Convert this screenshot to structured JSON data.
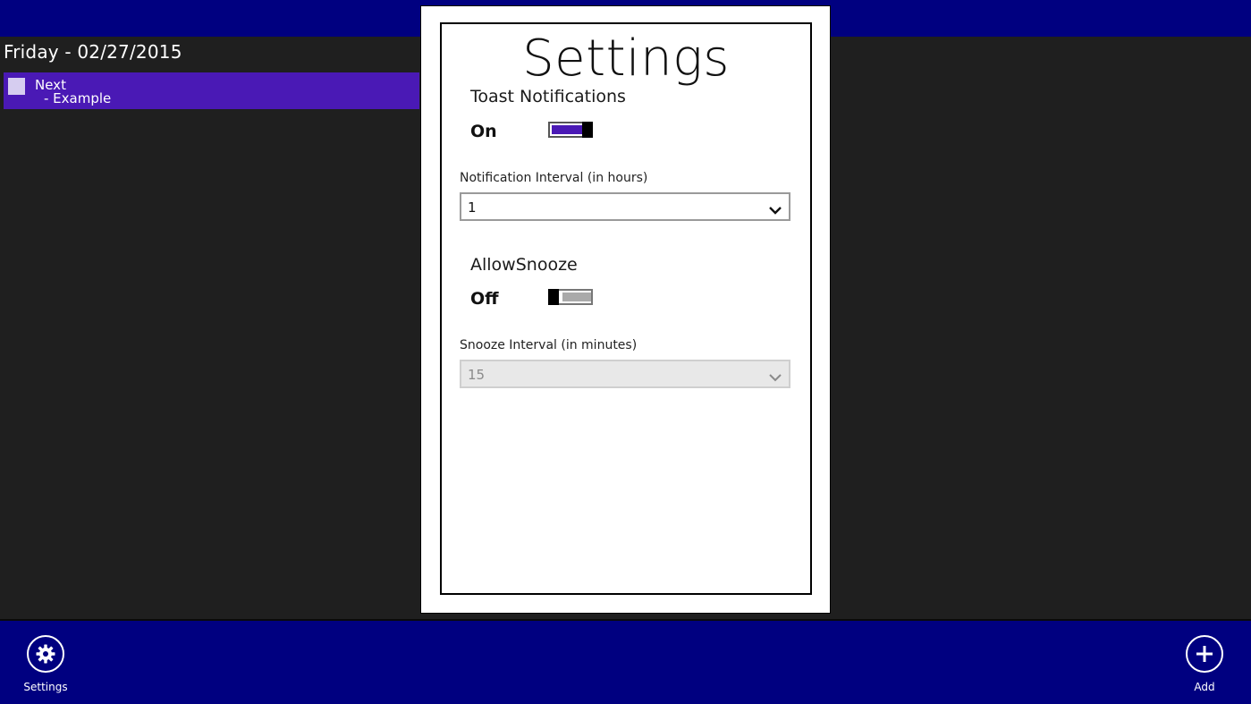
{
  "app": {
    "date_header": "Friday - 02/27/2015",
    "task": {
      "title": "Next",
      "subtitle": "- Example"
    }
  },
  "settings": {
    "title": "Settings",
    "toast": {
      "label": "Toast Notifications",
      "state": "On",
      "enabled": true
    },
    "notification_interval": {
      "label": "Notification Interval (in hours)",
      "value": "1"
    },
    "snooze": {
      "label": "AllowSnooze",
      "state": "Off",
      "enabled": false
    },
    "snooze_interval": {
      "label": "Snooze Interval (in minutes)",
      "value": "15",
      "disabled": true
    }
  },
  "appbar": {
    "settings_label": "Settings",
    "add_label": "Add"
  },
  "icons": {
    "settings": "gear-icon",
    "add": "plus-icon",
    "dropdown": "chevron-down-icon"
  },
  "colors": {
    "bar_blue": "#000080",
    "accent_purple": "#4a19b5",
    "background": "#1f1f1f"
  }
}
